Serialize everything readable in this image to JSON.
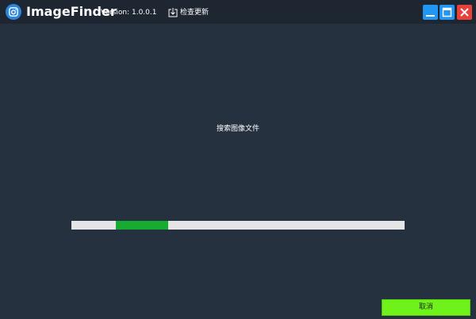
{
  "app": {
    "title": "ImageFinder",
    "version": "Version: 1.0.0.1",
    "check_update_label": "检查更新"
  },
  "window_controls": {
    "minimize_icon": "minimize-icon",
    "maximize_icon": "maximize-icon",
    "close_icon": "close-icon"
  },
  "main": {
    "status_text": "搜索图像文件",
    "progress": {
      "indeterminate": true,
      "highlight_start": 0.134,
      "highlight_end": 0.291
    },
    "cancel_label": "取消"
  },
  "colors": {
    "background": "#263140",
    "titlebar": "#1d2631",
    "accent_blue": "#2196f3",
    "close_red": "#e8413a",
    "progress_fill": "#16ab31",
    "progress_track": "#e5e5e5",
    "cancel_button": "#6ff21a"
  }
}
